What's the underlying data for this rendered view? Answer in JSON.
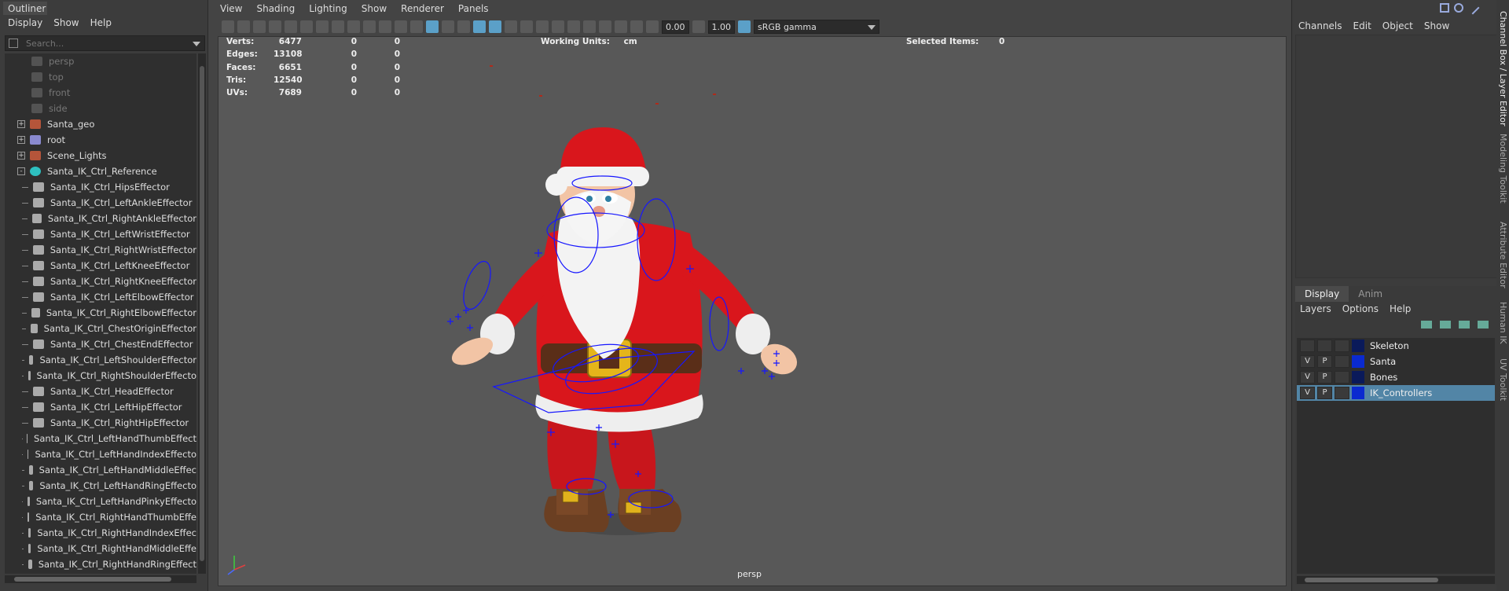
{
  "outliner": {
    "tab": "Outliner",
    "menu": [
      "Display",
      "Show",
      "Help"
    ],
    "search_placeholder": "Search...",
    "items": [
      {
        "label": "persp",
        "type": "camera",
        "dim": true
      },
      {
        "label": "top",
        "type": "camera",
        "dim": true
      },
      {
        "label": "front",
        "type": "camera",
        "dim": true
      },
      {
        "label": "side",
        "type": "camera",
        "dim": true
      },
      {
        "label": "Santa_geo",
        "type": "group",
        "expand": "+"
      },
      {
        "label": "root",
        "type": "joint",
        "expand": "+"
      },
      {
        "label": "Scene_Lights",
        "type": "group",
        "expand": "+"
      },
      {
        "label": "Santa_IK_Ctrl_Reference",
        "type": "reference",
        "expand": "-"
      },
      {
        "label": "Santa_IK_Ctrl_HipsEffector",
        "type": "effector"
      },
      {
        "label": "Santa_IK_Ctrl_LeftAnkleEffector",
        "type": "effector"
      },
      {
        "label": "Santa_IK_Ctrl_RightAnkleEffector",
        "type": "effector"
      },
      {
        "label": "Santa_IK_Ctrl_LeftWristEffector",
        "type": "effector"
      },
      {
        "label": "Santa_IK_Ctrl_RightWristEffector",
        "type": "effector"
      },
      {
        "label": "Santa_IK_Ctrl_LeftKneeEffector",
        "type": "effector"
      },
      {
        "label": "Santa_IK_Ctrl_RightKneeEffector",
        "type": "effector"
      },
      {
        "label": "Santa_IK_Ctrl_LeftElbowEffector",
        "type": "effector"
      },
      {
        "label": "Santa_IK_Ctrl_RightElbowEffector",
        "type": "effector"
      },
      {
        "label": "Santa_IK_Ctrl_ChestOriginEffector",
        "type": "effector"
      },
      {
        "label": "Santa_IK_Ctrl_ChestEndEffector",
        "type": "effector"
      },
      {
        "label": "Santa_IK_Ctrl_LeftShoulderEffector",
        "type": "effector"
      },
      {
        "label": "Santa_IK_Ctrl_RightShoulderEffecto",
        "type": "effector"
      },
      {
        "label": "Santa_IK_Ctrl_HeadEffector",
        "type": "effector"
      },
      {
        "label": "Santa_IK_Ctrl_LeftHipEffector",
        "type": "effector"
      },
      {
        "label": "Santa_IK_Ctrl_RightHipEffector",
        "type": "effector"
      },
      {
        "label": "Santa_IK_Ctrl_LeftHandThumbEffect",
        "type": "effector"
      },
      {
        "label": "Santa_IK_Ctrl_LeftHandIndexEffecto",
        "type": "effector"
      },
      {
        "label": "Santa_IK_Ctrl_LeftHandMiddleEffec",
        "type": "effector"
      },
      {
        "label": "Santa_IK_Ctrl_LeftHandRingEffecto",
        "type": "effector"
      },
      {
        "label": "Santa_IK_Ctrl_LeftHandPinkyEffecto",
        "type": "effector"
      },
      {
        "label": "Santa_IK_Ctrl_RightHandThumbEffe",
        "type": "effector"
      },
      {
        "label": "Santa_IK_Ctrl_RightHandIndexEffec",
        "type": "effector"
      },
      {
        "label": "Santa_IK_Ctrl_RightHandMiddleEffe",
        "type": "effector"
      },
      {
        "label": "Santa_IK_Ctrl_RightHandRingEffect",
        "type": "effector"
      }
    ]
  },
  "viewport": {
    "menu": [
      "View",
      "Shading",
      "Lighting",
      "Show",
      "Renderer",
      "Panels"
    ],
    "exposure": "0.00",
    "gamma": "1.00",
    "color_space": "sRGB gamma",
    "hud": {
      "rows": [
        {
          "label": "Verts:",
          "v1": "6477",
          "v2": "0",
          "v3": "0"
        },
        {
          "label": "Edges:",
          "v1": "13108",
          "v2": "0",
          "v3": "0"
        },
        {
          "label": "Faces:",
          "v1": "6651",
          "v2": "0",
          "v3": "0"
        },
        {
          "label": "Tris:",
          "v1": "12540",
          "v2": "0",
          "v3": "0"
        },
        {
          "label": "UVs:",
          "v1": "7689",
          "v2": "0",
          "v3": "0"
        }
      ],
      "working_units_label": "Working Units:",
      "working_units_value": "cm",
      "selected_label": "Selected Items:",
      "selected_value": "0"
    },
    "camera_name": "persp"
  },
  "channel_box": {
    "menu": [
      "Channels",
      "Edit",
      "Object",
      "Show"
    ],
    "side_tabs": [
      "Channel Box / Layer Editor",
      "Modeling Toolkit",
      "Attribute Editor",
      "Human IK",
      "UV Toolkit"
    ]
  },
  "layer_editor": {
    "tabs": [
      "Display",
      "Anim"
    ],
    "menu": [
      "Layers",
      "Options",
      "Help"
    ],
    "layers": [
      {
        "name": "Skeleton",
        "v": "",
        "p": "",
        "color": "#0a1a5a",
        "selected": false
      },
      {
        "name": "Santa",
        "v": "V",
        "p": "P",
        "color": "#0a2ad0",
        "selected": false
      },
      {
        "name": "Bones",
        "v": "V",
        "p": "P",
        "color": "#0a1a5a",
        "selected": false
      },
      {
        "name": "IK_Controllers",
        "v": "V",
        "p": "P",
        "color": "#0a2ad0",
        "selected": true
      }
    ]
  }
}
